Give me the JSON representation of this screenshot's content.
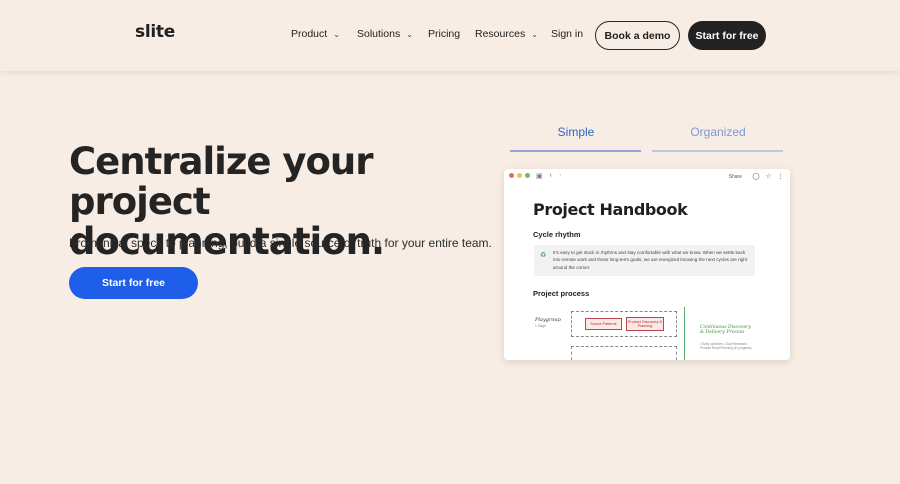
{
  "brand": {
    "logo": "slite"
  },
  "nav": {
    "product": "Product",
    "solutions": "Solutions",
    "pricing": "Pricing",
    "resources": "Resources",
    "signin": "Sign in",
    "book_demo": "Book a demo",
    "start_free": "Start for free"
  },
  "hero": {
    "title_line1": "Centralize your",
    "title_line2": "project documentation.",
    "subtitle": "From initial specs to planning, build a single source of truth for your entire team.",
    "cta": "Start for free"
  },
  "tabs": {
    "simple": "Simple",
    "organized": "Organized"
  },
  "preview": {
    "share": "Share",
    "doc_title": "Project Handbook",
    "section1": "Cycle rhythm",
    "callout": "It’s easy to get stuck in rhythms and stay comfortable with what we know. When we settle back into remote work and those long-term goals, we are energized knowing the next cycles are right around the corner.",
    "section2": "Project process",
    "flow_label": "Playgroup",
    "flow_sub": "1 Stage",
    "box1": "Sound Patterns",
    "box2": "Product Discovery & Planning",
    "green_note": "Continuous Discovery & Delivery Process",
    "small_notes": "• Early sketches  • Gap Research  • Product Road Planning (in progress)"
  },
  "colors": {
    "background": "#f8ede4",
    "primary_blue": "#1f5ee8",
    "dark_button": "#222222",
    "tab_active": "#2f63c7",
    "tab_inactive": "#7a9ad4"
  }
}
